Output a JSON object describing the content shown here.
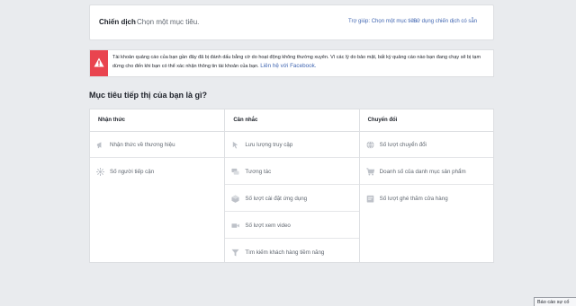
{
  "campaign": {
    "title": "Chiến dịch",
    "subtitle": "Chọn một mục tiêu.",
    "help_link": "Trợ giúp: Chọn một mục tiêu",
    "existing_link": "Sử dụng chiến dịch có sẵn"
  },
  "alert": {
    "message": "Tài khoản quảng cáo của bạn gần đây đã bị đánh dấu bằng cờ do hoạt động không thường xuyên. Vì các lý do bảo mật, bất kỳ quảng cáo nào bạn đang chạy sẽ bị tạm dừng cho đến khi bạn có thể xác nhận thông tin tài khoản của bạn.",
    "link": "Liên hệ với Facebook.",
    "color": "#e9444f"
  },
  "objective_heading": "Mục tiêu tiếp thị của bạn là gì?",
  "columns": [
    {
      "header": "Nhận thức",
      "items": [
        {
          "label": "Nhận thức về thương hiệu",
          "icon": "megaphone-icon"
        },
        {
          "label": "Số người tiếp cận",
          "icon": "reach-icon"
        }
      ]
    },
    {
      "header": "Cân nhắc",
      "items": [
        {
          "label": "Lưu lượng truy cập",
          "icon": "cursor-icon"
        },
        {
          "label": "Tương tác",
          "icon": "chat-icon"
        },
        {
          "label": "Số lượt cài đặt ứng dụng",
          "icon": "app-cube-icon"
        },
        {
          "label": "Số lượt xem video",
          "icon": "video-icon"
        },
        {
          "label": "Tìm kiếm khách hàng tiềm năng",
          "icon": "funnel-icon"
        }
      ]
    },
    {
      "header": "Chuyển đổi",
      "items": [
        {
          "label": "Số lượt chuyển đổi",
          "icon": "globe-icon"
        },
        {
          "label": "Doanh số của danh mục sản phẩm",
          "icon": "cart-icon"
        },
        {
          "label": "Số lượt ghé thăm cửa hàng",
          "icon": "store-icon"
        }
      ]
    }
  ],
  "report_button": "Báo cáo sự cố",
  "accent_color": "#4267b2"
}
